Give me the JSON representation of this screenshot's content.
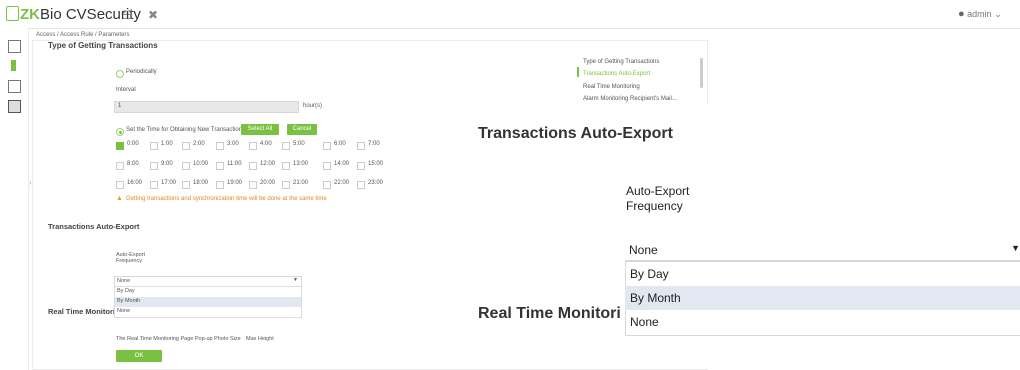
{
  "app": {
    "logo_prefix": "ZK",
    "logo_rest": "Bio CVSecurity",
    "user": "admin"
  },
  "breadcrumb": "Access / Access Rule / Parameters",
  "section_top": {
    "title": "Type of Getting Transactions"
  },
  "periodically": {
    "label": "Periodically",
    "interval_label": "Interval",
    "interval_value": "1",
    "unit": "hour(s)"
  },
  "set_time": {
    "label": "Set the Time for Obtaining New Transactions",
    "select_all": "Select All",
    "cancel": "Cancel"
  },
  "times": [
    "0:00",
    "1:00",
    "2:00",
    "3:00",
    "4:00",
    "5:00",
    "6:00",
    "7:00",
    "8:00",
    "9:00",
    "10:00",
    "11:00",
    "12:00",
    "13:00",
    "14:00",
    "15:00",
    "16:00",
    "17:00",
    "18:00",
    "19:00",
    "20:00",
    "21:00",
    "22:00",
    "23:00"
  ],
  "warning": "Getting transactions and synchronization time will be done at the same time",
  "auto_export": {
    "title": "Transactions Auto-Export",
    "freq_label_line1": "Auto-Export",
    "freq_label_line2": "Frequency",
    "selected": "None",
    "options": [
      "By Day",
      "By Month",
      "None"
    ]
  },
  "real_time": {
    "title": "Real Time Monitoring",
    "title_cut": "Real Time Monitori",
    "photo_label": "The Real Time Monitoring Page Pop-up Photo Size",
    "max_height": "Max Height"
  },
  "ok": "OK",
  "right_nav": [
    "Type of Getting Transactions",
    "Transactions Auto-Export",
    "Real Time Monitoring",
    "Alarm Monitoring Recipient's Mail..."
  ],
  "colors": {
    "accent": "#7ac143",
    "warning": "#f0a020",
    "highlight": "#e2e8f1"
  }
}
